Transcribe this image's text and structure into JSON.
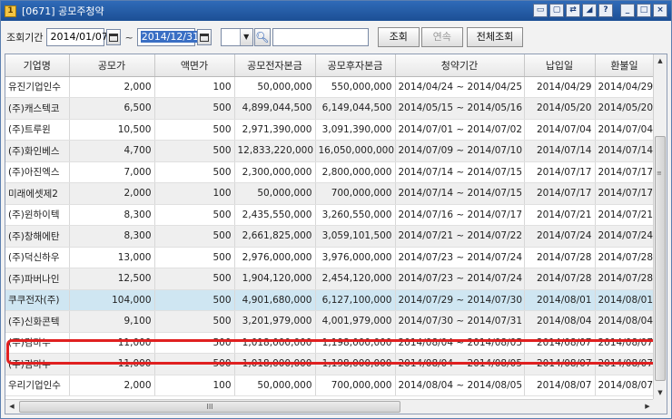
{
  "window": {
    "title": "[0671] 공모주청약",
    "icon": "app-icon",
    "icon_char": "1"
  },
  "toolbar": {
    "period_label": "조회기간",
    "start_date": "2014/01/07",
    "tilde": "~",
    "end_date": "2014/12/31",
    "code_value": "",
    "search_value": "",
    "query_btn": "조회",
    "next_btn": "연속",
    "all_btn": "전체조회"
  },
  "table": {
    "headers": [
      "기업명",
      "공모가",
      "액면가",
      "공모전자본금",
      "공모후자본금",
      "청약기간",
      "납입일",
      "환불일"
    ],
    "rows": [
      [
        "유진기업인수",
        "2,000",
        "100",
        "50,000,000",
        "550,000,000",
        "2014/04/24 ~ 2014/04/25",
        "2014/04/29",
        "2014/04/29"
      ],
      [
        "(주)캐스텍코",
        "6,500",
        "500",
        "4,899,044,500",
        "6,149,044,500",
        "2014/05/15 ~ 2014/05/16",
        "2014/05/20",
        "2014/05/20"
      ],
      [
        "(주)트루윈",
        "10,500",
        "500",
        "2,971,390,000",
        "3,091,390,000",
        "2014/07/01 ~ 2014/07/02",
        "2014/07/04",
        "2014/07/04"
      ],
      [
        "(주)화인베스",
        "4,700",
        "500",
        "12,833,220,000",
        "16,050,000,000",
        "2014/07/09 ~ 2014/07/10",
        "2014/07/14",
        "2014/07/14"
      ],
      [
        "(주)아진엑스",
        "7,000",
        "500",
        "2,300,000,000",
        "2,800,000,000",
        "2014/07/14 ~ 2014/07/15",
        "2014/07/17",
        "2014/07/17"
      ],
      [
        "미래에셋제2",
        "2,000",
        "100",
        "50,000,000",
        "700,000,000",
        "2014/07/14 ~ 2014/07/15",
        "2014/07/17",
        "2014/07/17"
      ],
      [
        "(주)윈하이텍",
        "8,300",
        "500",
        "2,435,550,000",
        "3,260,550,000",
        "2014/07/16 ~ 2014/07/17",
        "2014/07/21",
        "2014/07/21"
      ],
      [
        "(주)창해에탄",
        "8,300",
        "500",
        "2,661,825,000",
        "3,059,101,500",
        "2014/07/21 ~ 2014/07/22",
        "2014/07/24",
        "2014/07/24"
      ],
      [
        "(주)덕신하우",
        "13,000",
        "500",
        "2,976,000,000",
        "3,976,000,000",
        "2014/07/23 ~ 2014/07/24",
        "2014/07/28",
        "2014/07/28"
      ],
      [
        "(주)파버나인",
        "12,500",
        "500",
        "1,904,120,000",
        "2,454,120,000",
        "2014/07/23 ~ 2014/07/24",
        "2014/07/28",
        "2014/07/28"
      ],
      [
        "쿠쿠전자(주)",
        "104,000",
        "500",
        "4,901,680,000",
        "6,127,100,000",
        "2014/07/29 ~ 2014/07/30",
        "2014/08/01",
        "2014/08/01"
      ],
      [
        "(주)신화콘텍",
        "9,100",
        "500",
        "3,201,979,000",
        "4,001,979,000",
        "2014/07/30 ~ 2014/07/31",
        "2014/08/04",
        "2014/08/04"
      ],
      [
        "(주)감마누",
        "11,000",
        "500",
        "1,018,000,000",
        "1,198,000,000",
        "2014/08/04 ~ 2014/08/05",
        "2014/08/07",
        "2014/08/07"
      ],
      [
        "(주)감마누",
        "11,000",
        "500",
        "1,018,000,000",
        "1,198,000,000",
        "2014/08/04 ~ 2014/08/05",
        "2014/08/07",
        "2014/08/07"
      ],
      [
        "우리기업인수",
        "2,000",
        "100",
        "50,000,000",
        "700,000,000",
        "2014/08/04 ~ 2014/08/05",
        "2014/08/07",
        "2014/08/07"
      ]
    ],
    "highlighted_row": 10
  },
  "scroll": {
    "grip": "≡",
    "hgrip": "III"
  }
}
